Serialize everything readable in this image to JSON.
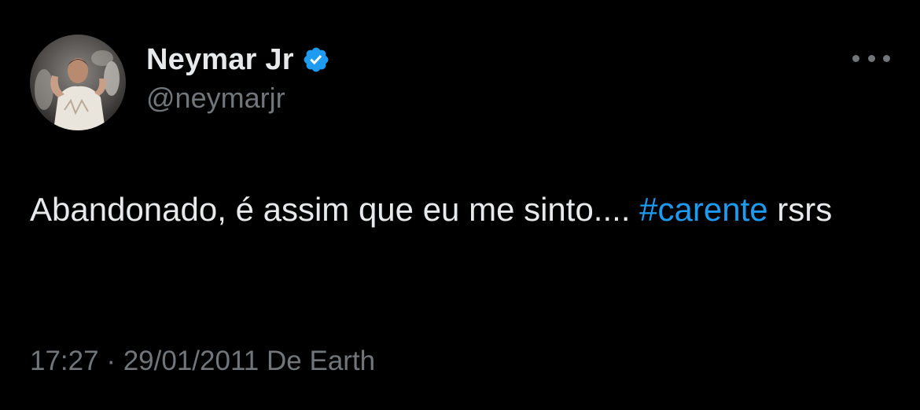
{
  "author": {
    "display_name": "Neymar Jr",
    "handle": "@neymarjr",
    "verified_icon": "verified-badge-icon",
    "avatar": "profile-photo"
  },
  "tweet": {
    "text_before": "Abandonado, é assim que eu me sinto.... ",
    "hashtag": "#carente",
    "text_after": " rsrs"
  },
  "meta": {
    "time": "17:27",
    "separator": " · ",
    "date": "29/01/2011",
    "source": " De Earth"
  },
  "colors": {
    "background": "#000000",
    "primary_text": "#e7e9ea",
    "secondary_text": "#71767b",
    "accent": "#1d9bf0"
  },
  "menu": {
    "icon": "more-options-icon"
  }
}
